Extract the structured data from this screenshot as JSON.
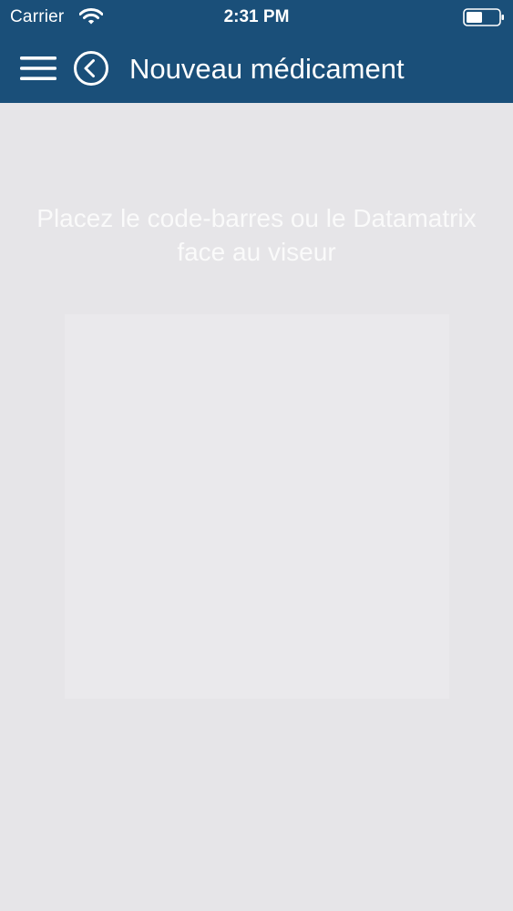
{
  "status_bar": {
    "carrier": "Carrier",
    "time": "2:31 PM",
    "icons": [
      "wifi-icon",
      "battery-icon"
    ]
  },
  "header": {
    "title": "Nouveau médicament",
    "icons": [
      "menu-icon",
      "back-icon"
    ]
  },
  "scanner": {
    "instruction": "Placez le code-barres ou le Datamatrix face au viseur"
  },
  "colors": {
    "header_background": "#1a4f79",
    "page_background": "#e6e5e8",
    "viewfinder_background": "#eae9ec",
    "header_text": "#ffffff",
    "instruction_text": "#fafafa"
  }
}
